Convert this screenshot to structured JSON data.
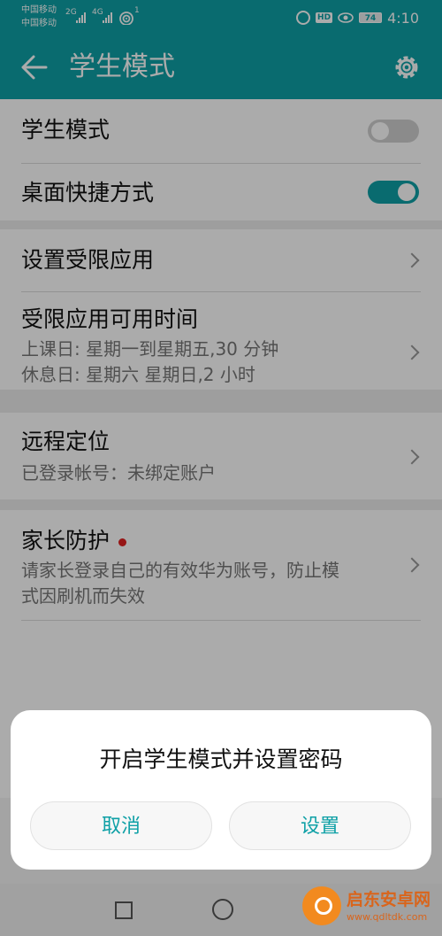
{
  "status_bar": {
    "carrier1": "中国移动",
    "carrier2": "中国移动",
    "net1": "2G",
    "net2": "4G",
    "wifi_badge": "1",
    "hd": "HD",
    "battery": "74",
    "time": "4:10"
  },
  "header": {
    "title": "学生模式"
  },
  "settings": {
    "student_mode": {
      "label": "学生模式",
      "on": false
    },
    "shortcut": {
      "label": "桌面快捷方式",
      "on": true
    },
    "restricted_apps": {
      "label": "设置受限应用"
    },
    "restricted_time": {
      "label": "受限应用可用时间",
      "line1": "上课日: 星期一到星期五,30 分钟",
      "line2": "休息日: 星期六 星期日,2 小时"
    },
    "remote_location": {
      "label": "远程定位",
      "sub": "已登录帐号：未绑定账户"
    },
    "parent_protect": {
      "label": "家长防护",
      "line1": "请家长登录自己的有效华为账号，防止模",
      "line2": "式因刷机而失效"
    }
  },
  "dialog": {
    "title": "开启学生模式并设置密码",
    "cancel": "取消",
    "confirm": "设置"
  },
  "watermark": {
    "text": "启东安卓网",
    "url": "www.qdltdk.com"
  },
  "colors": {
    "accent": "#0ea0a6",
    "dot": "#e02020"
  }
}
